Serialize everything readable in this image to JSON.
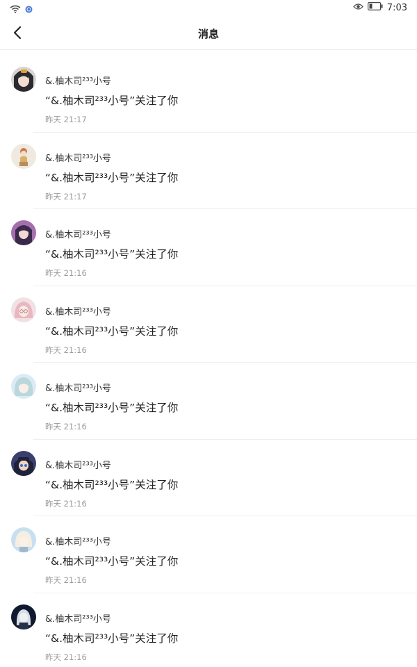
{
  "status_bar": {
    "time": "7:03",
    "icons": [
      "wifi-icon",
      "sync-icon",
      "eye-icon",
      "battery-icon"
    ]
  },
  "header": {
    "title": "消息",
    "back_icon": "chevron-left-icon"
  },
  "messages": [
    {
      "name": "&.柚木司²³³小号",
      "text": "“&.柚木司²³³小号”关注了你",
      "time": "昨天 21:17"
    },
    {
      "name": "&.柚木司²³³小号",
      "text": "“&.柚木司²³³小号”关注了你",
      "time": "昨天 21:17"
    },
    {
      "name": "&.柚木司²³³小号",
      "text": "“&.柚木司²³³小号”关注了你",
      "time": "昨天 21:16"
    },
    {
      "name": "&.柚木司²³³小号",
      "text": "“&.柚木司²³³小号”关注了你",
      "time": "昨天 21:16"
    },
    {
      "name": "&.柚木司²³³小号",
      "text": "“&.柚木司²³³小号”关注了你",
      "time": "昨天 21:16"
    },
    {
      "name": "&.柚木司²³³小号",
      "text": "“&.柚木司²³³小号”关注了你",
      "time": "昨天 21:16"
    },
    {
      "name": "&.柚木司²³³小号",
      "text": "“&.柚木司²³³小号”关注了你",
      "time": "昨天 21:16"
    },
    {
      "name": "&.柚木司²³³小号",
      "text": "“&.柚木司²³³小号”关注了你",
      "time": "昨天 21:16"
    }
  ]
}
